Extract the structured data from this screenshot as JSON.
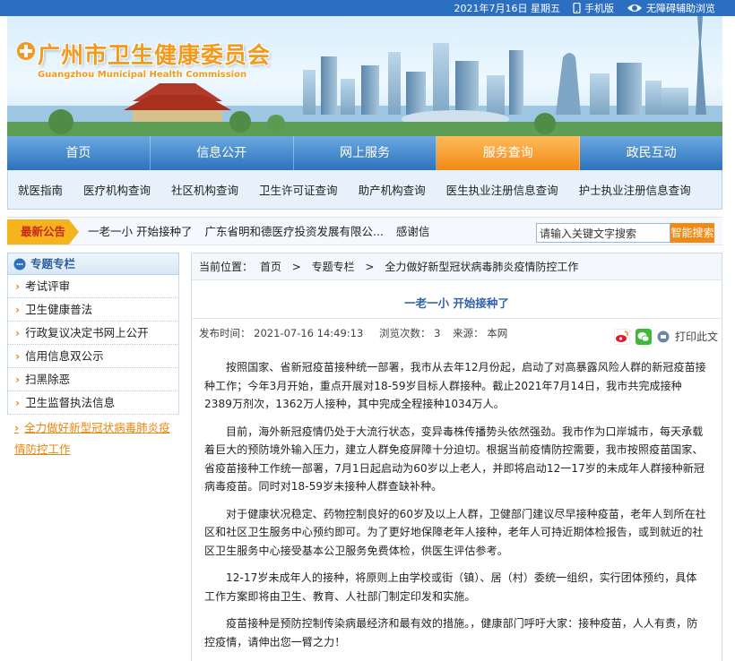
{
  "topbar": {
    "date": "2021年7月16日 星期五",
    "mobile": "手机版",
    "accessible": "无障碍辅助浏览"
  },
  "logo": {
    "title": "广州市卫生健康委员会",
    "subtitle": "Guangzhou Municipal Health Commission"
  },
  "nav": [
    "首页",
    "信息公开",
    "网上服务",
    "服务查询",
    "政民互动"
  ],
  "nav_active": 3,
  "subnav": [
    "就医指南",
    "医疗机构查询",
    "社区机构查询",
    "卫生许可证查询",
    "助产机构查询",
    "医生执业注册信息查询",
    "护士执业注册信息查询"
  ],
  "notice": {
    "label": "最新公告",
    "items": [
      "一老一小 开始接种了",
      "广东省明和德医疗投资发展有限公...",
      "感谢信"
    ]
  },
  "search": {
    "value": "请输入关键文字搜索",
    "button": "智能搜索"
  },
  "sidebar": {
    "title": "专题专栏",
    "items": [
      "考试评审",
      "卫生健康普法",
      "行政复议决定书网上公开",
      "信用信息双公示",
      "扫黑除恶",
      "卫生监督执法信息"
    ],
    "current": "全力做好新型冠状病毒肺炎疫情防控工作"
  },
  "breadcrumb": {
    "label": "当前位置：",
    "items": [
      "首页",
      "专题专栏",
      "全力做好新型冠状病毒肺炎疫情防控工作"
    ],
    "sep": ">"
  },
  "article": {
    "title": "一老一小 开始接种了",
    "publish_label": "发布时间：",
    "publish_time": "2021-07-16 14:49:13",
    "views_label": "浏览次数：",
    "views": "3",
    "source_label": "来源：",
    "source": "本网",
    "print_label": "打印此文",
    "paragraphs": [
      "按照国家、省新冠疫苗接种统一部署，我市从去年12月份起，启动了对高暴露风险人群的新冠疫苗接种工作；今年3月开始，重点开展对18-59岁目标人群接种。截止2021年7月14日，我市共完成接种2389万剂次，1362万人接种，其中完成全程接种1034万人。",
      "目前，海外新冠疫情仍处于大流行状态，变异毒株传播势头依然强劲。我市作为口岸城市，每天承载着巨大的预防境外输入压力，建立人群免疫屏障十分迫切。根据当前疫情防控需要，我市按照疫苗国家、省疫苗接种工作统一部署，7月1日起启动为60岁以上老人，并即将启动12一17岁的未成年人群接种新冠病毒疫苗。同时对18-59岁未接种人群查缺补种。",
      "对于健康状况稳定、药物控制良好的60岁及以上人群，卫健部门建议尽早接种疫苗，老年人到所在社区和社区卫生服务中心预约即可。为了更好地保障老年人接种，老年人可持近期体检报告，或到就近的社区卫生服务中心接受基本公卫服务免费体检，供医生评估参考。",
      "12-17岁未成年人的接种，将原则上由学校或街（镇）、居（村）委统一组织，实行团体预约，具体工作方案即将由卫生、教育、人社部门制定印发和实施。",
      "疫苗接种是预防控制传染病最经济和最有效的措施。，健康部门呼吁大家：接种疫苗，人人有责，防控疫情，请伸出您一臂之力！"
    ]
  },
  "colors": {
    "nav_blue": "#2d72bd",
    "accent_orange": "#f08a14",
    "title_blue": "#2f62a8"
  }
}
